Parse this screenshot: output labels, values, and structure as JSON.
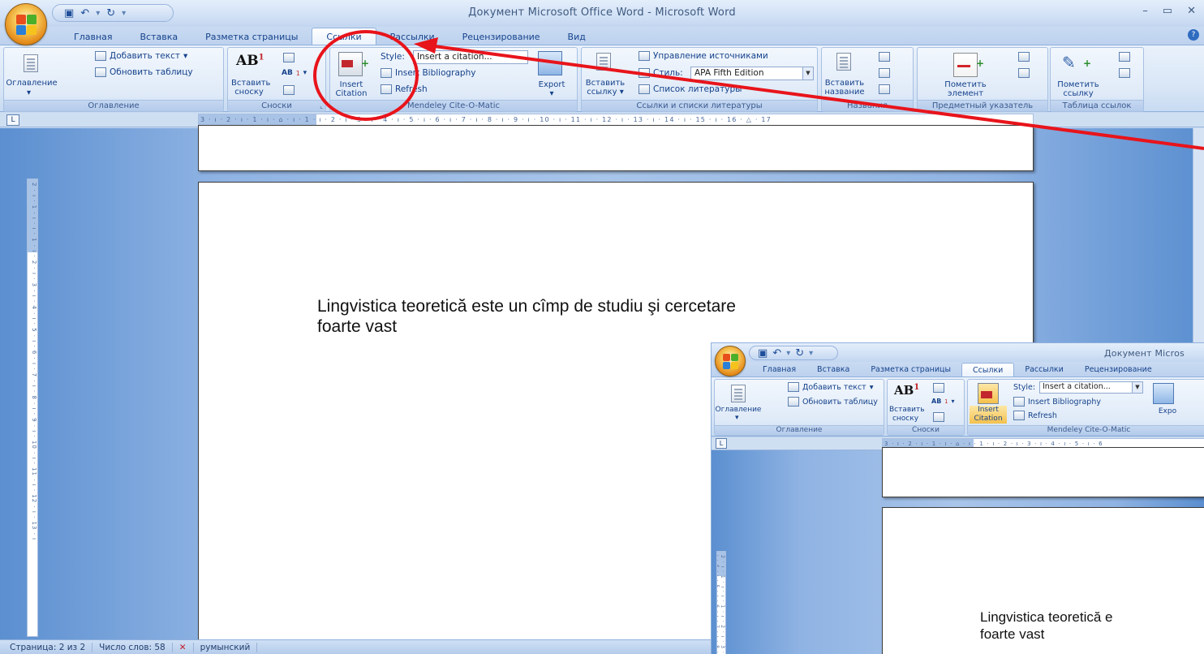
{
  "window": {
    "title": "Документ Microsoft Office Word - Microsoft Word",
    "controls": [
      "–",
      "▭",
      "✕"
    ]
  },
  "tabs": [
    "Главная",
    "Вставка",
    "Разметка страницы",
    "Ссылки",
    "Рассылки",
    "Рецензирование",
    "Вид"
  ],
  "active_tab": "Ссылки",
  "ribbon": {
    "toc": {
      "add_text": "Добавить текст",
      "update_table": "Обновить таблицу",
      "toc_button": "Оглавление",
      "group_label": "Оглавление"
    },
    "footnotes": {
      "insert_footnote_line1": "Вставить",
      "insert_footnote_line2": "сноску",
      "group_label": "Сноски"
    },
    "mendeley": {
      "style_label": "Style:",
      "style_value": "Insert a citation...",
      "insert_bibliography": "Insert Bibliography",
      "refresh": "Refresh",
      "insert_citation_line1": "Insert",
      "insert_citation_line2": "Citation",
      "export": "Export",
      "group_label": "Mendeley Cite-O-Matic"
    },
    "citations": {
      "manage_sources": "Управление источниками",
      "style_label": "Стиль:",
      "style_value": "APA Fifth Edition",
      "bibliography": "Список литературы",
      "insert_link_line1": "Вставить",
      "insert_link_line2": "ссылку",
      "group_label": "Ссылки и списки литературы"
    },
    "captions": {
      "insert_caption_line1": "Вставить",
      "insert_caption_line2": "название",
      "group_label": "Названия"
    },
    "index": {
      "mark_entry_line1": "Пометить",
      "mark_entry_line2": "элемент",
      "group_label": "Предметный указатель"
    },
    "toa": {
      "mark_citation_line1": "Пометить",
      "mark_citation_line2": "ссылку",
      "group_label": "Таблица ссылок"
    }
  },
  "ruler": {
    "horizontal_text": "3 · ı · 2 · ı · 1 · ı · ⌂ · ı · 1 · ı · 2 · ı · 3 · ı · 4 · ı · 5 · ı · 6 · ı · 7 · ı · 8 · ı · 9 · ı · 10 · ı · 11 · ı · 12 · ı · 13 · ı · 14 · ı · 15 · ı · 16 · △ · 17",
    "vertical_text": "2 · ı · 1 · ı · ı · 1 · ı · 2 · ı · 3 · ı · 4 · ı · 5 · ı · 6 · ı · 7 · ı · 8 · ı · 9 · ı · 10 · ı · 11 · ı · 12 · ı · 13 · ı"
  },
  "document": {
    "line1": "Lingvistica teoretică este un cîmp de studiu şi cercetare",
    "line2": "foarte vast"
  },
  "status": {
    "page": "Страница: 2 из 2",
    "words": "Число слов: 58",
    "language": "румынский"
  },
  "inset": {
    "title": "Документ Micros",
    "ribbon_mendeley_export": "Expo",
    "doc_line1": "Lingvistica teoretică e",
    "doc_line2": "foarte vast",
    "ruler_text": "3 · ı · 2 · ı · 1 · ı · ⌂ · ı · 1 · ı · 2 · ı · 3 · ı · 4 · ı · 5 · ı · 6"
  },
  "colors": {
    "annotation_red": "#e8141b",
    "ribbon_text": "#15428b"
  },
  "icons": {
    "office_button": "office-logo-icon",
    "save": "save-icon",
    "undo": "undo-icon",
    "redo": "redo-icon"
  }
}
